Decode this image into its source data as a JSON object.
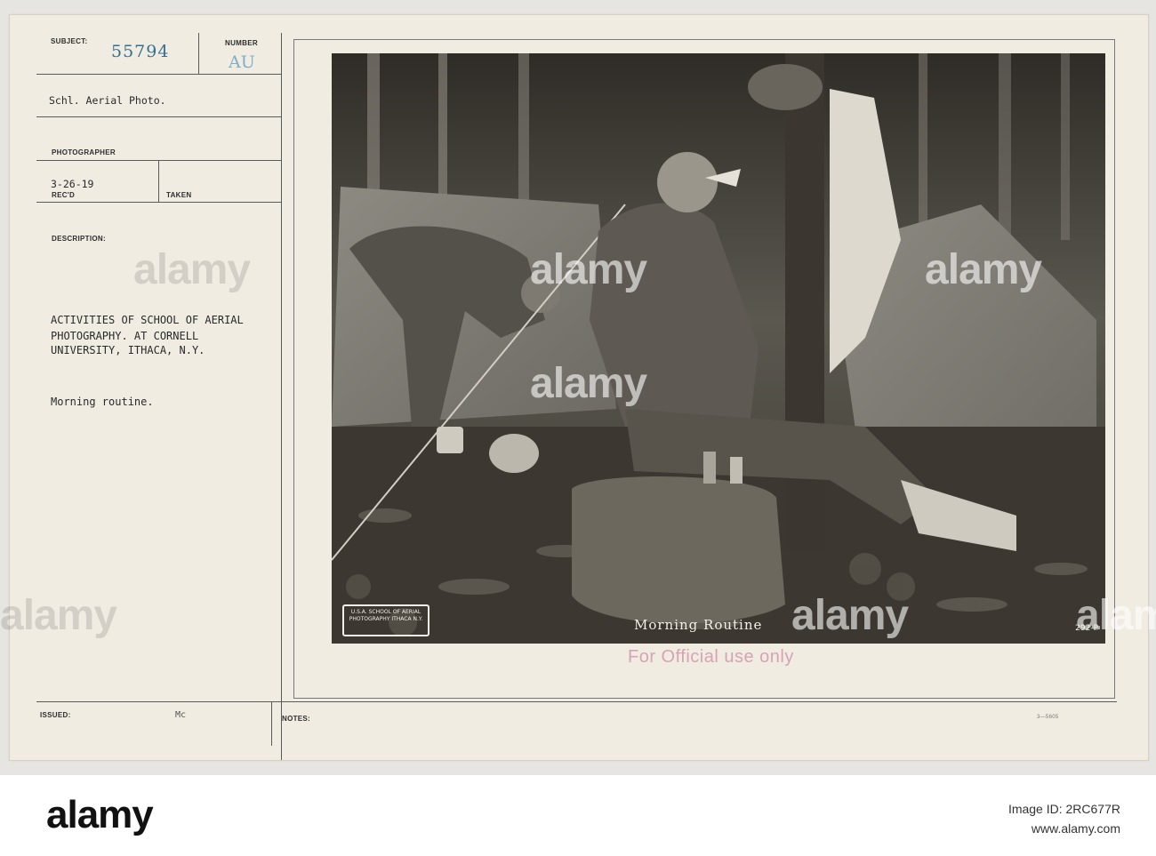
{
  "card": {
    "subject_label": "SUBJECT:",
    "subject_number": "55794",
    "number_label": "NUMBER",
    "number_code": "AU",
    "source": "Schl. Aerial Photo.",
    "photographer_label": "PHOTOGRAPHER",
    "date": "3-26-19",
    "recd_label": "REC'D",
    "taken_label": "TAKEN",
    "description_label": "DESCRIPTION:",
    "description_lines": [
      "ACTIVITIES OF SCHOOL OF AERIAL",
      "PHOTOGRAPHY. AT CORNELL",
      "UNIVERSITY, ITHACA, N.Y."
    ],
    "description_note": "Morning routine.",
    "issued_label": "ISSUED:",
    "issued_value": "Mc",
    "notes_label": "NOTES:",
    "form_code": "3—5605"
  },
  "photo": {
    "caption": "Morning Routine",
    "studio_stamp": "U.S.A. SCHOOL OF AERIAL PHOTOGRAPHY ITHACA N.Y.",
    "plate_number": "292-P",
    "official_stamp": "For Official use only"
  },
  "watermark": {
    "text": "alamy"
  },
  "footer": {
    "logo": "alamy",
    "image_id_label": "Image ID: 2RC677R",
    "url": "www.alamy.com"
  }
}
